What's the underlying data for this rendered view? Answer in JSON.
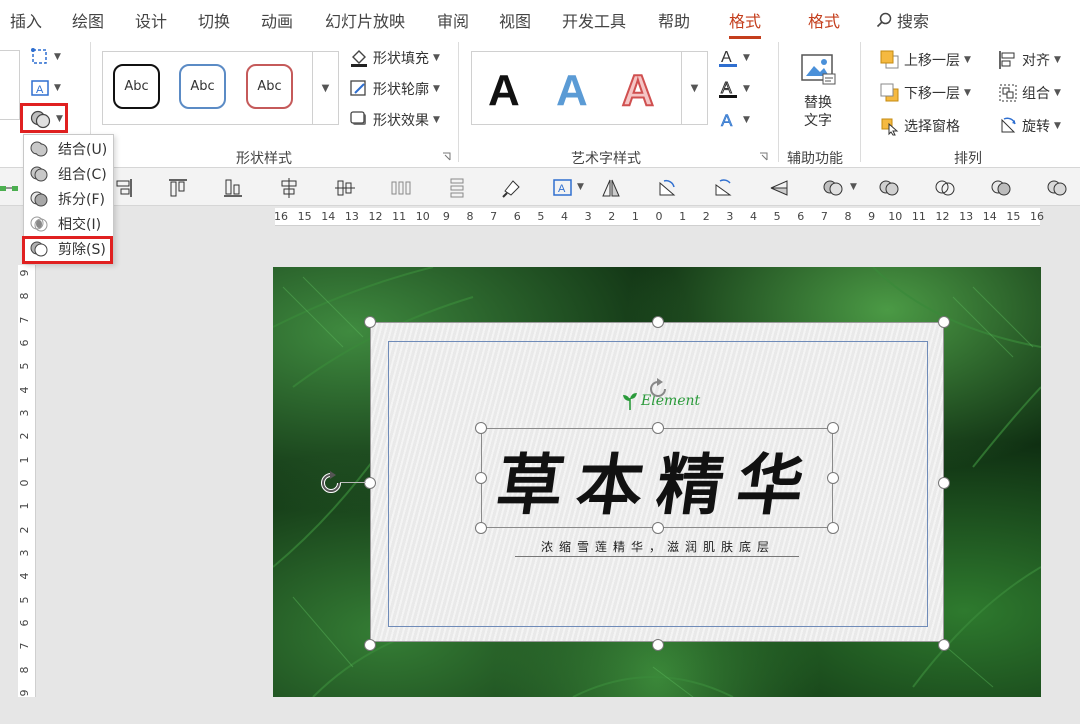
{
  "tabs": [
    "插入",
    "绘图",
    "设计",
    "切换",
    "动画",
    "幻灯片放映",
    "审阅",
    "视图",
    "开发工具",
    "帮助",
    "格式",
    "格式"
  ],
  "search_label": "搜索",
  "ribbon": {
    "shape_style_previews": [
      "Abc",
      "Abc",
      "Abc"
    ],
    "shape_fill": "形状填充",
    "shape_outline": "形状轮廓",
    "shape_effects": "形状效果",
    "shape_styles_group": "形状样式",
    "wordart_previews": [
      "A",
      "A",
      "A"
    ],
    "wordart_group": "艺术字样式",
    "alt_text_line1": "替换",
    "alt_text_line2": "文字",
    "accessibility_group": "辅助功能",
    "bring_forward": "上移一层",
    "send_backward": "下移一层",
    "selection_pane": "选择窗格",
    "align": "对齐",
    "group": "组合",
    "rotate": "旋转",
    "arrange_group": "排列"
  },
  "merge_menu": {
    "items": [
      "结合(U)",
      "组合(C)",
      "拆分(F)",
      "相交(I)",
      "剪除(S)"
    ],
    "highlighted": "剪除(S)"
  },
  "ruler": {
    "horizontal": [
      "16",
      "15",
      "14",
      "13",
      "12",
      "11",
      "10",
      "9",
      "8",
      "7",
      "6",
      "5",
      "4",
      "3",
      "2",
      "1",
      "0",
      "1",
      "2",
      "3",
      "4",
      "5",
      "6",
      "7",
      "8",
      "9",
      "10",
      "11",
      "12",
      "13",
      "14",
      "15",
      "16"
    ],
    "vertical": [
      "9",
      "8",
      "7",
      "6",
      "5",
      "4",
      "3",
      "2",
      "1",
      "0",
      "1",
      "2",
      "3",
      "4",
      "5",
      "6",
      "7",
      "8",
      "9"
    ]
  },
  "slide": {
    "logo_text": "Element",
    "title": "草本精华",
    "subtitle": "浓缩雪莲精华，滋润肌肤底层"
  },
  "colors": {
    "accent": "#c43e1c",
    "highlight_box": "#e02020",
    "wordart_blue": "#5b9bd5",
    "wordart_red": "#e06060",
    "logo_green": "#2a9a3a"
  }
}
